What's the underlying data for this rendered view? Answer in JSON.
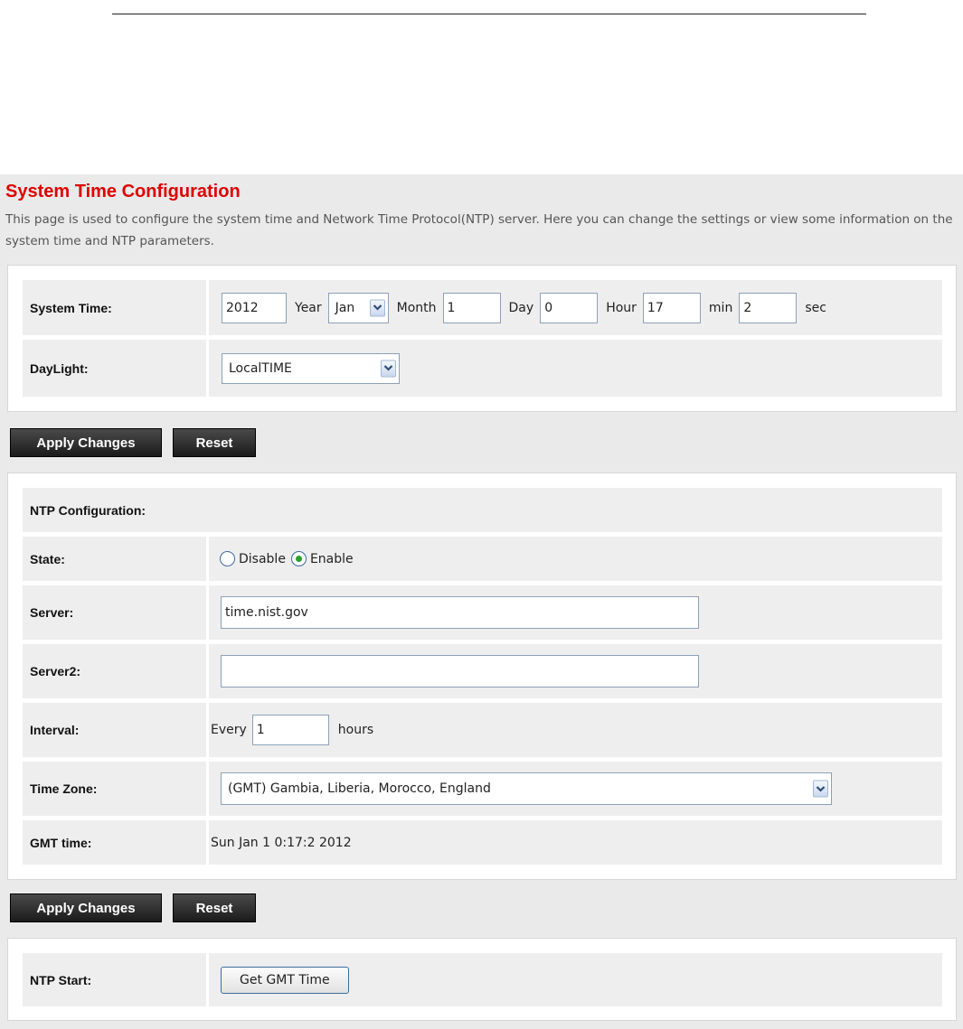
{
  "page": {
    "title": "System Time Configuration",
    "description": "This page is used to configure the system time and Network Time Protocol(NTP) server. Here you can change the settings or view some information on the system time and NTP parameters."
  },
  "system_time": {
    "label": "System Time:",
    "year": "2012",
    "year_unit": "Year",
    "month": "Jan",
    "month_unit": "Month",
    "day": "1",
    "day_unit": "Day",
    "hour": "0",
    "hour_unit": "Hour",
    "min": "17",
    "min_unit": "min",
    "sec": "2",
    "sec_unit": "sec"
  },
  "daylight": {
    "label": "DayLight:",
    "value": "LocalTIME"
  },
  "buttons": {
    "apply": "Apply Changes",
    "reset": "Reset",
    "get_gmt": "Get GMT Time"
  },
  "ntp": {
    "heading": "NTP Configuration:",
    "state_label": "State:",
    "state_options": [
      "Disable",
      "Enable"
    ],
    "state_selected": "Enable",
    "server_label": "Server:",
    "server_value": "time.nist.gov",
    "server2_label": "Server2:",
    "server2_value": "",
    "interval_label": "Interval:",
    "interval_prefix": "Every",
    "interval_value": "1",
    "interval_unit": "hours",
    "timezone_label": "Time Zone:",
    "timezone_value": "(GMT) Gambia, Liberia, Morocco, England",
    "gmt_label": "GMT time:",
    "gmt_value": "Sun Jan 1 0:17:2 2012"
  },
  "ntp_start": {
    "label": "NTP Start:"
  },
  "icons": {
    "dropdown": "chevron-down-icon",
    "radio_selected_color": "#2ca02c"
  }
}
